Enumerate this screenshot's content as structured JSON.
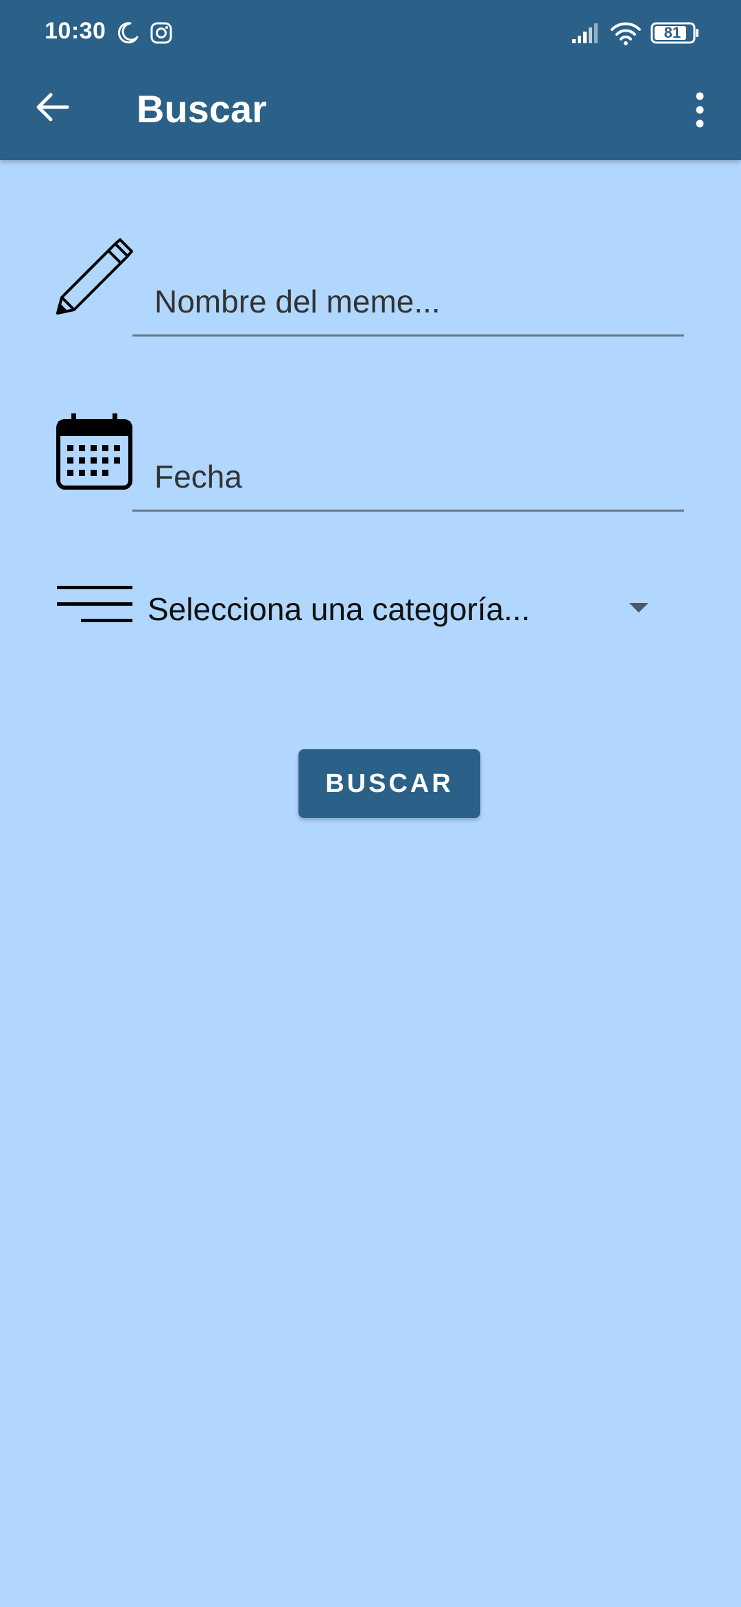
{
  "status_bar": {
    "time": "10:30",
    "battery": "81"
  },
  "toolbar": {
    "title": "Buscar"
  },
  "form": {
    "name_placeholder": "Nombre del meme...",
    "date_placeholder": "Fecha",
    "category_selected": "Selecciona una categoría..."
  },
  "search_button": {
    "label": "BUSCAR"
  },
  "colors": {
    "primary": "#2b6188",
    "background": "#b1d7fe"
  },
  "icons": [
    "back-arrow-icon",
    "more-vert-icon",
    "pencil-icon",
    "calendar-icon",
    "sort-lines-icon",
    "dropdown-arrow-icon",
    "moon-icon",
    "instagram-icon",
    "signal-icon",
    "wifi-icon",
    "battery-icon"
  ]
}
